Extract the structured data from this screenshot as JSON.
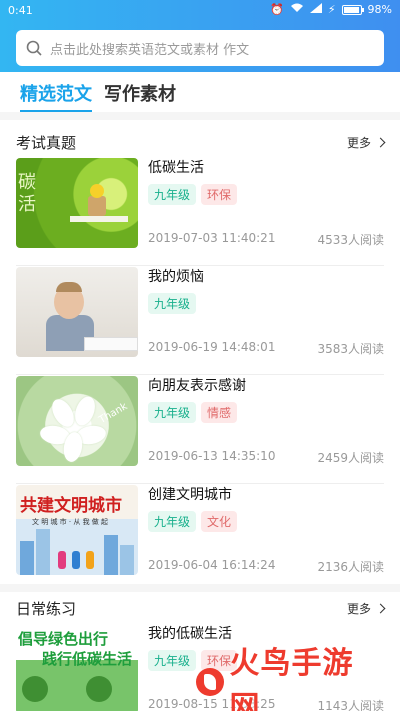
{
  "status_bar": {
    "time": "0:41",
    "battery": "98%",
    "battery_level": 0.98
  },
  "search": {
    "placeholder": "点击此处搜索英语范文或素材  作文"
  },
  "tabs": [
    {
      "label": "精选范文",
      "active": true
    },
    {
      "label": "写作素材",
      "active": false
    }
  ],
  "sections": [
    {
      "title": "考试真题",
      "more": "更多"
    },
    {
      "title": "日常练习",
      "more": "更多"
    }
  ],
  "articles": [
    {
      "title": "低碳生活",
      "tags": [
        "九年级",
        "环保"
      ],
      "date": "2019-07-03 11:40:21",
      "reads": "4533人阅读",
      "thumb_text": "碳\n活"
    },
    {
      "title": "我的烦恼",
      "tags": [
        "九年级"
      ],
      "date": "2019-06-19 14:48:01",
      "reads": "3583人阅读"
    },
    {
      "title": "向朋友表示感谢",
      "tags": [
        "九年级",
        "情感"
      ],
      "date": "2019-06-13 14:35:10",
      "reads": "2459人阅读",
      "thumb_text": "Thank"
    },
    {
      "title": "创建文明城市",
      "tags": [
        "九年级",
        "文化"
      ],
      "date": "2019-06-04 16:14:24",
      "reads": "2136人阅读",
      "thumb_text": "共建文明城市",
      "thumb_sub": "文 明 城 市 · 从 我 做 起"
    },
    {
      "title": "我的低碳生活",
      "tags": [
        "九年级",
        "环保"
      ],
      "date": "2019-08-15 11:53:25",
      "reads": "1143人阅读",
      "thumb_line1": "倡导绿色出行",
      "thumb_line2": "践行低碳生活"
    }
  ],
  "watermark": {
    "text": "火鸟手游网"
  },
  "colors": {
    "header_start": "#33b6f2",
    "header_end": "#3f8ff0",
    "accent": "#1aa3ea",
    "grade_tag": "#18b08c",
    "topic_tag": "#e06a6a"
  }
}
